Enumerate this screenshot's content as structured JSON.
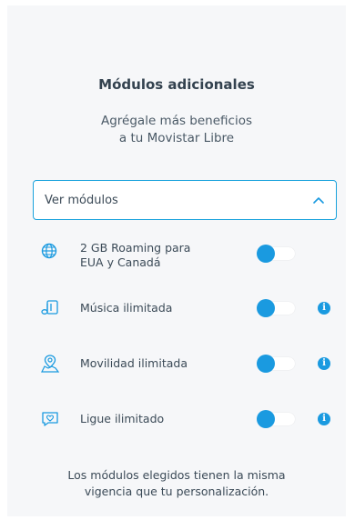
{
  "header": {
    "title": "Módulos adicionales",
    "subtitle_line1": "Agrégale más beneficios",
    "subtitle_line2": "a tu Movistar Libre"
  },
  "select": {
    "label": "Ver módulos",
    "icon": "chevron-up-icon"
  },
  "modules": [
    {
      "label_line1": "2 GB Roaming para",
      "label_line2": "EUA y Canadá",
      "icon": "globe-icon",
      "enabled": true,
      "has_info": false
    },
    {
      "label_line1": "Música ilimitada",
      "label_line2": "",
      "icon": "music-note-icon",
      "enabled": true,
      "has_info": true
    },
    {
      "label_line1": "Movilidad ilimitada",
      "label_line2": "",
      "icon": "map-location-icon",
      "enabled": true,
      "has_info": true
    },
    {
      "label_line1": "Ligue ilimitado",
      "label_line2": "",
      "icon": "chat-heart-icon",
      "enabled": true,
      "has_info": true
    }
  ],
  "info_glyph": "i",
  "footer": {
    "line1": "Los módulos elegidos tienen la misma",
    "line2": "vigencia que tu personalización."
  },
  "colors": {
    "accent": "#1a9ae0",
    "select_border": "#1aa2dc",
    "background": "#f6f7f9"
  }
}
